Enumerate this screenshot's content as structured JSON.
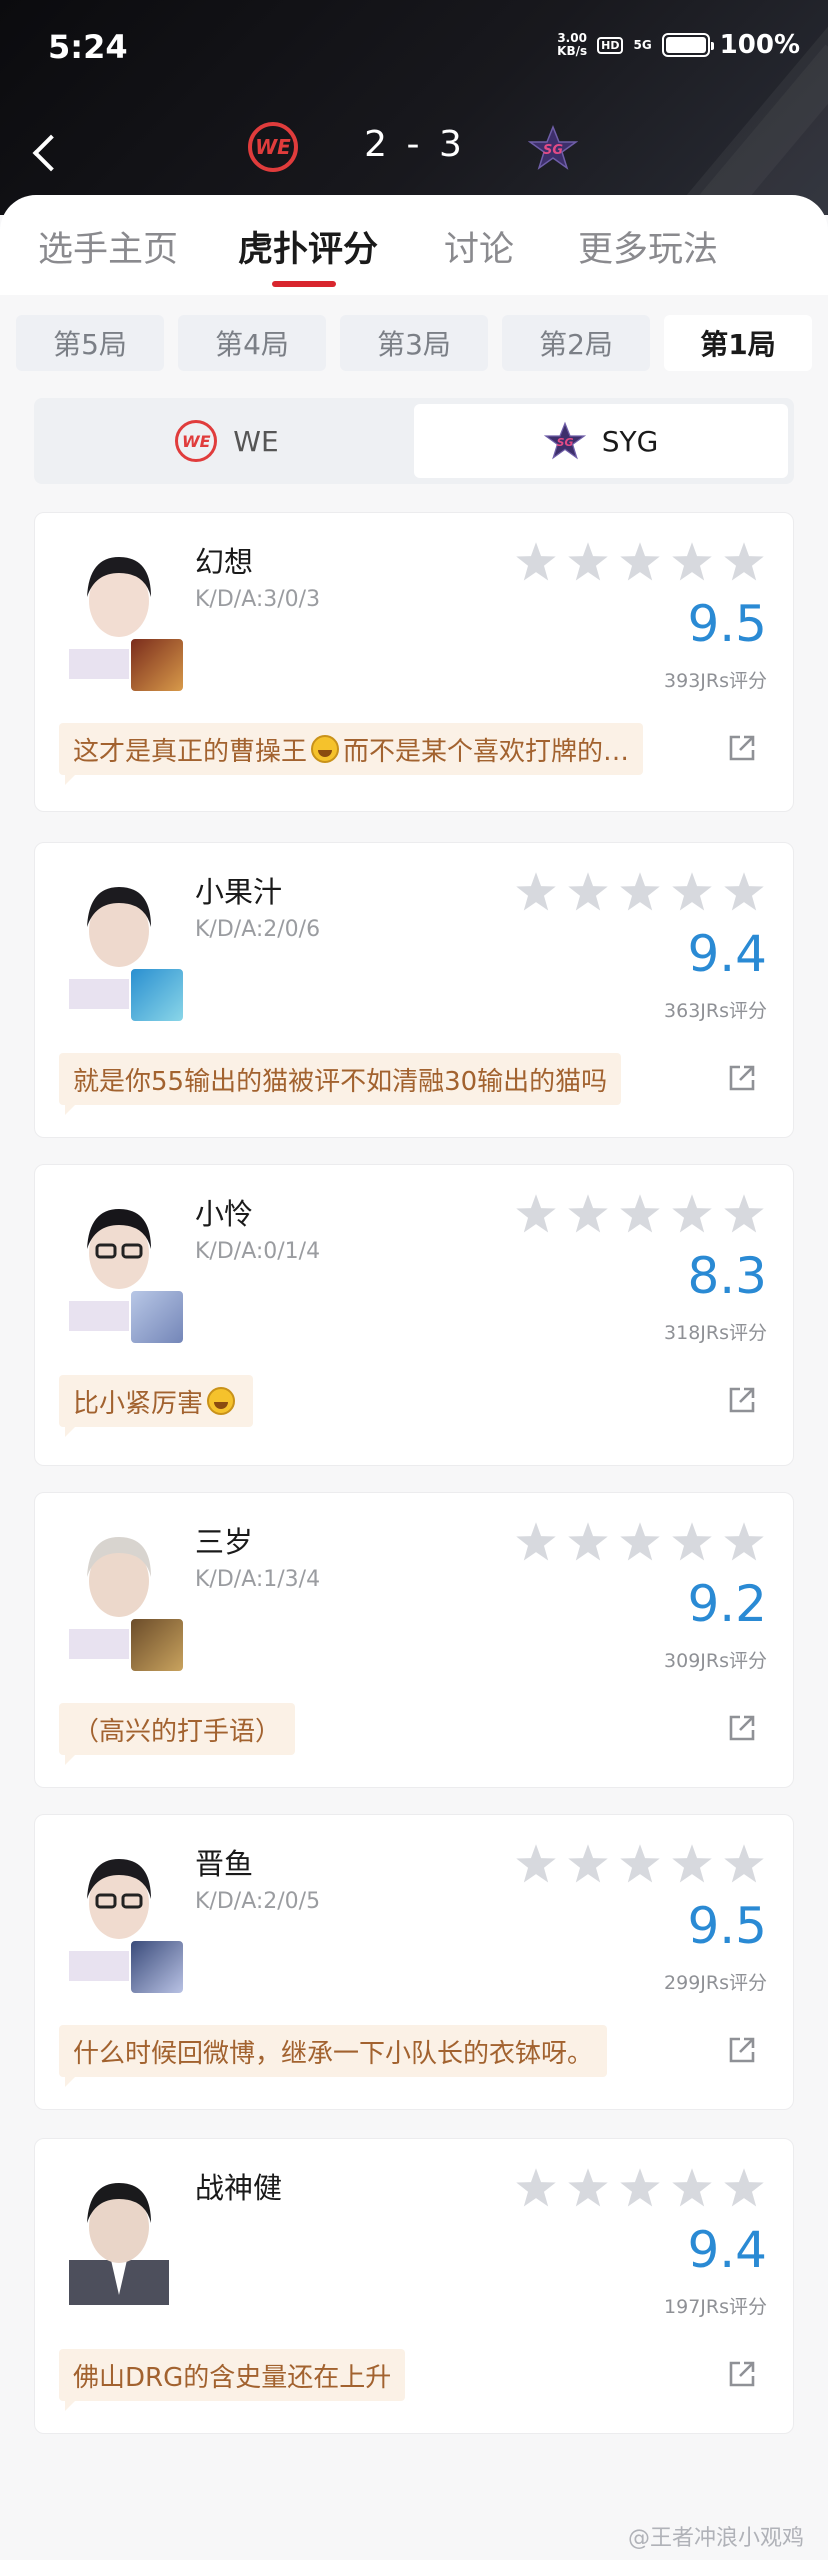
{
  "status_bar": {
    "time": "5:24",
    "net_speed_value": "3.00",
    "net_speed_unit": "KB/s",
    "hd": "HD",
    "signal": "5G",
    "battery": "100%"
  },
  "match": {
    "team_a": "WE",
    "team_b": "SYG",
    "score": "2 - 3"
  },
  "tabs": [
    "选手主页",
    "虎扑评分",
    "讨论",
    "更多玩法"
  ],
  "active_tab": 1,
  "rounds": [
    "第5局",
    "第4局",
    "第3局",
    "第2局",
    "第1局"
  ],
  "active_round": 4,
  "teams": [
    {
      "label": "WE"
    },
    {
      "label": "SYG"
    }
  ],
  "active_team": 1,
  "accent_color": "#d8262e",
  "rating_color": "#2a8ad4",
  "players": [
    {
      "name": "幻想",
      "kda": "K/D/A:3/0/3",
      "rating": "9.5",
      "raters": "393JRs评分",
      "comment_pre": "这才是真正的曹操王",
      "comment_emoji": true,
      "comment_post": "而不是某个喜欢打牌的…"
    },
    {
      "name": "小果汁",
      "kda": "K/D/A:2/0/6",
      "rating": "9.4",
      "raters": "363JRs评分",
      "comment_pre": "就是你55输出的猫被评不如清融30输出的猫吗",
      "comment_emoji": false,
      "comment_post": ""
    },
    {
      "name": "小怜",
      "kda": "K/D/A:0/1/4",
      "rating": "8.3",
      "raters": "318JRs评分",
      "comment_pre": "比小紧厉害",
      "comment_emoji": true,
      "comment_post": ""
    },
    {
      "name": "三岁",
      "kda": "K/D/A:1/3/4",
      "rating": "9.2",
      "raters": "309JRs评分",
      "comment_pre": "（高兴的打手语）",
      "comment_emoji": false,
      "comment_post": ""
    },
    {
      "name": "晋鱼",
      "kda": "K/D/A:2/0/5",
      "rating": "9.5",
      "raters": "299JRs评分",
      "comment_pre": "什么时候回微博，继承一下小队长的衣钵呀。",
      "comment_emoji": false,
      "comment_post": ""
    },
    {
      "name": "战神健",
      "kda": "",
      "rating": "9.4",
      "raters": "197JRs评分",
      "comment_pre": "佛山DRG的含史量还在上升",
      "comment_emoji": false,
      "comment_post": ""
    }
  ],
  "watermark": "@王者冲浪小观鸡"
}
